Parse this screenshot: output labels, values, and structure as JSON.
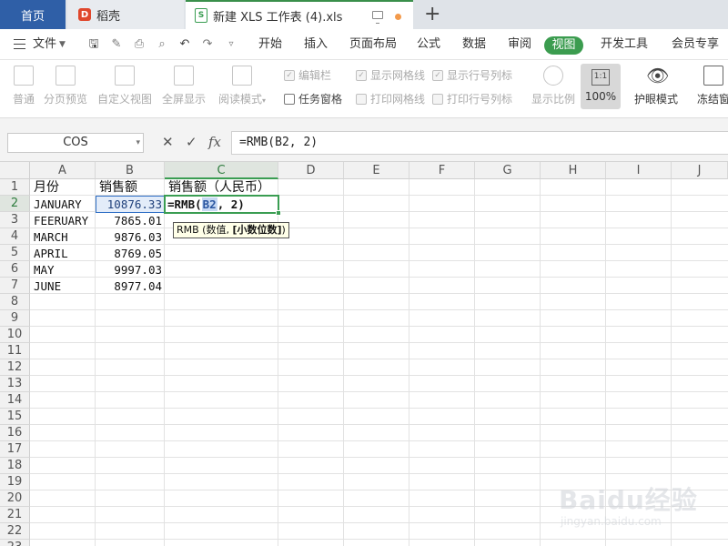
{
  "tabs": {
    "home": "首页",
    "doc": "稻壳",
    "active": "新建 XLS 工作表 (4).xls"
  },
  "menu": {
    "file": "文件",
    "items": [
      "开始",
      "插入",
      "页面布局",
      "公式",
      "数据",
      "审阅",
      "视图",
      "开发工具",
      "会员专享"
    ]
  },
  "ribbon": {
    "normal": "普通",
    "page_break": "分页预览",
    "custom_view": "自定义视图",
    "fullscreen": "全屏显示",
    "reading_mode": "阅读模式",
    "edit_bar": "编辑栏",
    "task_pane": "任务窗格",
    "show_gridlines": "显示网格线",
    "print_gridlines": "打印网格线",
    "show_headers": "显示行号列标",
    "print_headers": "打印行号列标",
    "zoom": "显示比例",
    "zoom100": "100%",
    "eye_mode": "护眼模式",
    "freeze": "冻结窗"
  },
  "formula_bar": {
    "name_box": "COS",
    "formula": "=RMB(B2, 2)"
  },
  "sheet": {
    "columns": [
      "A",
      "B",
      "C",
      "D",
      "E",
      "F",
      "G",
      "H",
      "I",
      "J"
    ],
    "rows": [
      "1",
      "2",
      "3",
      "4",
      "5",
      "6",
      "7",
      "8",
      "9",
      "10",
      "11",
      "12",
      "13",
      "14",
      "15",
      "16",
      "17",
      "18",
      "19",
      "20",
      "21",
      "22",
      "23"
    ],
    "header": {
      "a": "月份",
      "b": "销售额",
      "c": "销售额（人民币）"
    },
    "data": [
      {
        "month": "JANUARY",
        "sales": "10876.33"
      },
      {
        "month": "FEERUARY",
        "sales": "7865.01"
      },
      {
        "month": "MARCH",
        "sales": "9876.03"
      },
      {
        "month": "APRIL",
        "sales": "8769.05"
      },
      {
        "month": "MAY",
        "sales": "9997.03"
      },
      {
        "month": "JUNE",
        "sales": "8977.04"
      }
    ],
    "editing": {
      "prefix": "=RMB(",
      "ref": "B2",
      "suffix": ", 2)"
    },
    "tooltip": {
      "fn": "RMB (数值, ",
      "arg": "[小数位数]",
      "close": ")"
    }
  },
  "watermark": {
    "logo": "Baidu经验",
    "url": "jingyan.baidu.com"
  },
  "colors": {
    "accent": "#3a9d52",
    "home_tab": "#2f5fa7",
    "ref_blue": "#2f6fc5"
  }
}
